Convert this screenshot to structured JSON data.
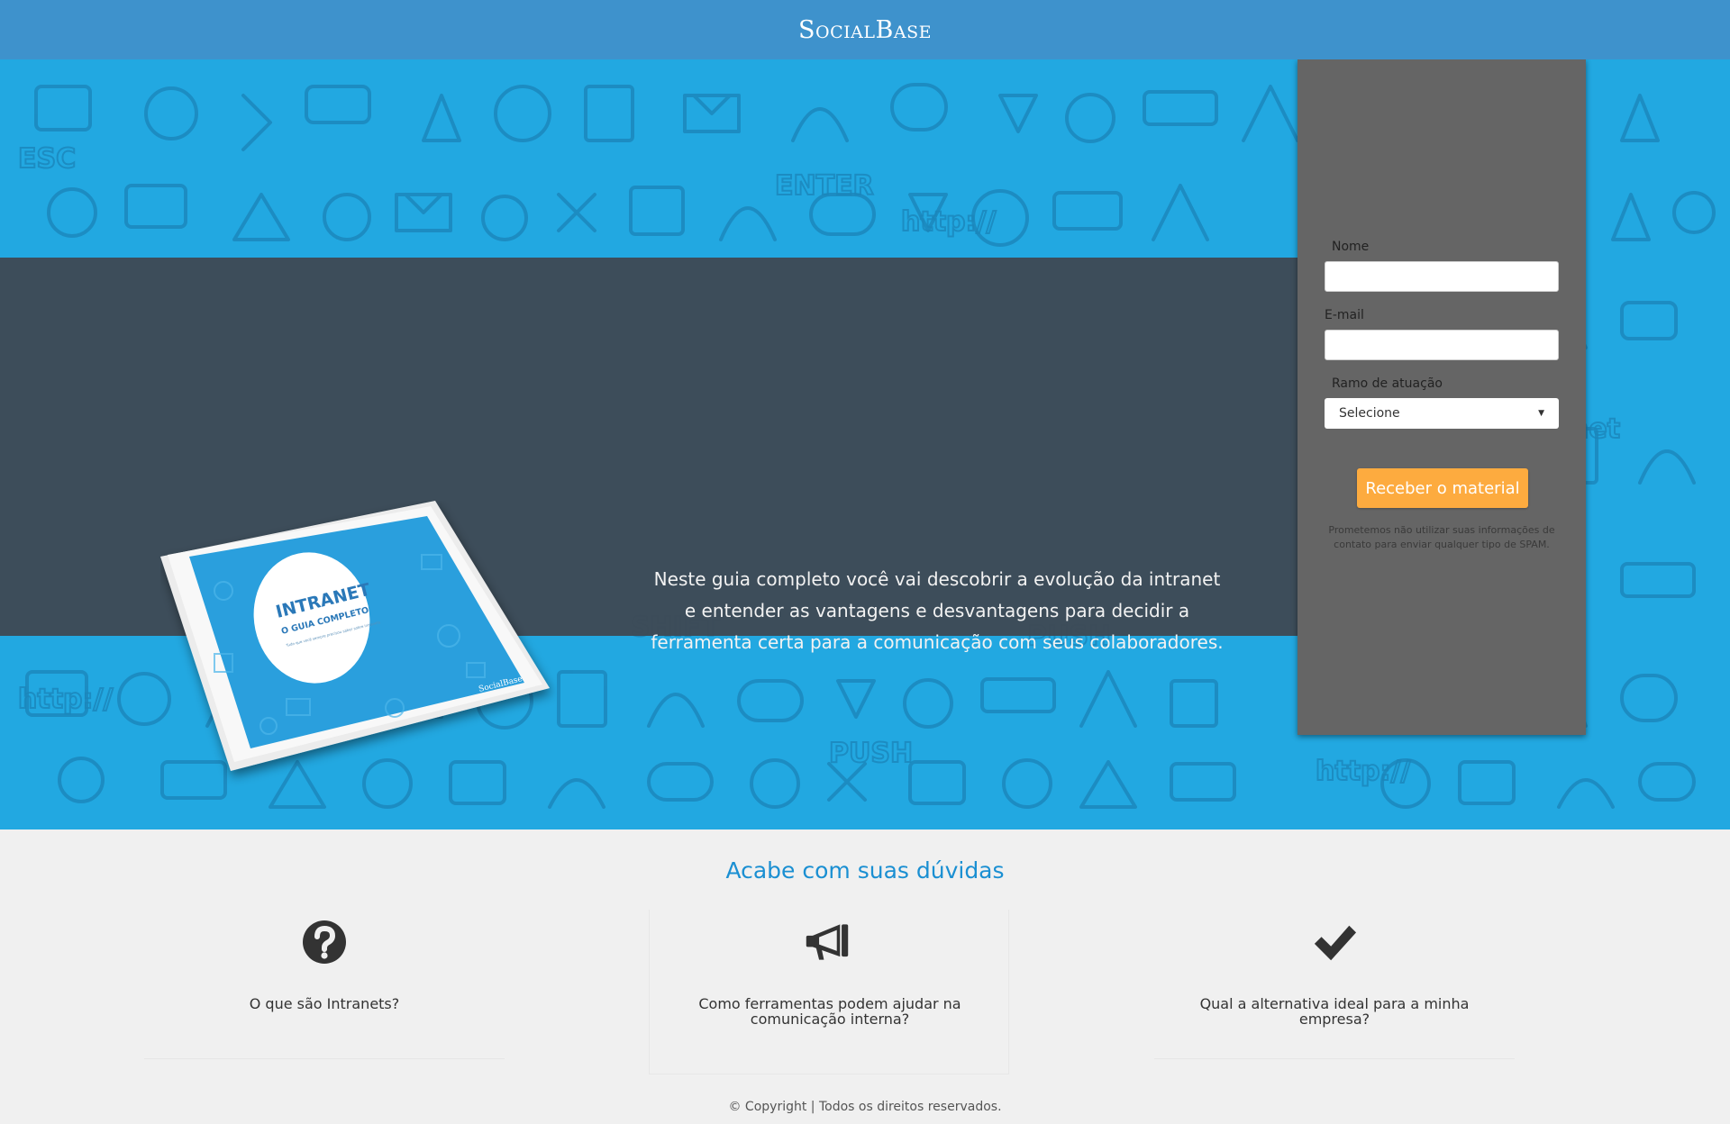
{
  "header": {
    "logo": "SocialBase"
  },
  "hero": {
    "description": "Neste guia completo você vai descobrir a evolução da intranet e entender as vantagens e desvantagens para decidir a ferramenta certa para a comunicação com seus colaboradores.",
    "ebook_cover": {
      "title": "INTRANET",
      "subtitle": "O GUIA COMPLETO",
      "tagline": "Tudo que você sempre precisou saber sobre intranets",
      "brand": "SocialBase"
    }
  },
  "form": {
    "name_label": "Nome",
    "email_label": "E-mail",
    "industry_label": "Ramo de atuação",
    "industry_selected": "Selecione",
    "submit_label": "Receber o material",
    "disclaimer": "Prometemos não utilizar suas informações de contato para enviar qualquer tipo de SPAM."
  },
  "faq": {
    "title": "Acabe com suas dúvidas",
    "items": [
      {
        "icon": "question-circle-icon",
        "text": "O que são Intranets?"
      },
      {
        "icon": "megaphone-icon",
        "text": "Como ferramentas podem ajudar na comunicação interna?"
      },
      {
        "icon": "checkmark-icon",
        "text": "Qual a alternativa ideal para a minha empresa?"
      }
    ]
  },
  "footer": {
    "copyright": "© Copyright | Todos os direitos reservados."
  },
  "colors": {
    "header_bg": "#3e92cc",
    "hero_bg": "#22a8e1",
    "band_bg": "#3e4a56",
    "form_bg": "#656565",
    "button_bg": "#fdab3f",
    "faq_title": "#1a8fd2"
  }
}
